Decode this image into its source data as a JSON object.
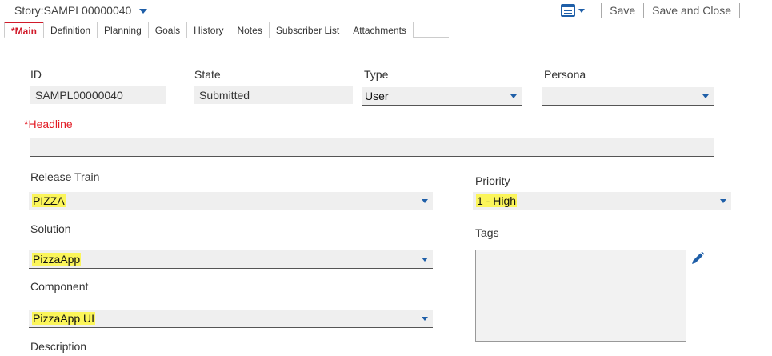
{
  "header": {
    "title": "Story:SAMPL00000040"
  },
  "toolbar": {
    "save": "Save",
    "save_close": "Save and Close"
  },
  "tabs": [
    {
      "label": "*Main"
    },
    {
      "label": "Definition"
    },
    {
      "label": "Planning"
    },
    {
      "label": "Goals"
    },
    {
      "label": "History"
    },
    {
      "label": "Notes"
    },
    {
      "label": "Subscriber List"
    },
    {
      "label": "Attachments"
    }
  ],
  "form": {
    "id": {
      "label": "ID",
      "value": "SAMPL00000040"
    },
    "state": {
      "label": "State",
      "value": "Submitted"
    },
    "type": {
      "label": "Type",
      "value": "User"
    },
    "persona": {
      "label": "Persona",
      "value": ""
    },
    "headline": {
      "required_mark": "*",
      "label": "Headline",
      "value": ""
    },
    "release_train": {
      "label": "Release Train",
      "value": "PIZZA"
    },
    "priority": {
      "label": "Priority",
      "value": "1 - High"
    },
    "solution": {
      "label": "Solution",
      "value": "PizzaApp"
    },
    "tags": {
      "label": "Tags"
    },
    "component": {
      "label": "Component",
      "value": "PizzaApp UI"
    },
    "description": {
      "label": "Description"
    }
  },
  "colors": {
    "accent": "#1f5fa8",
    "required": "#e21a23",
    "highlight": "#fbf55a"
  }
}
